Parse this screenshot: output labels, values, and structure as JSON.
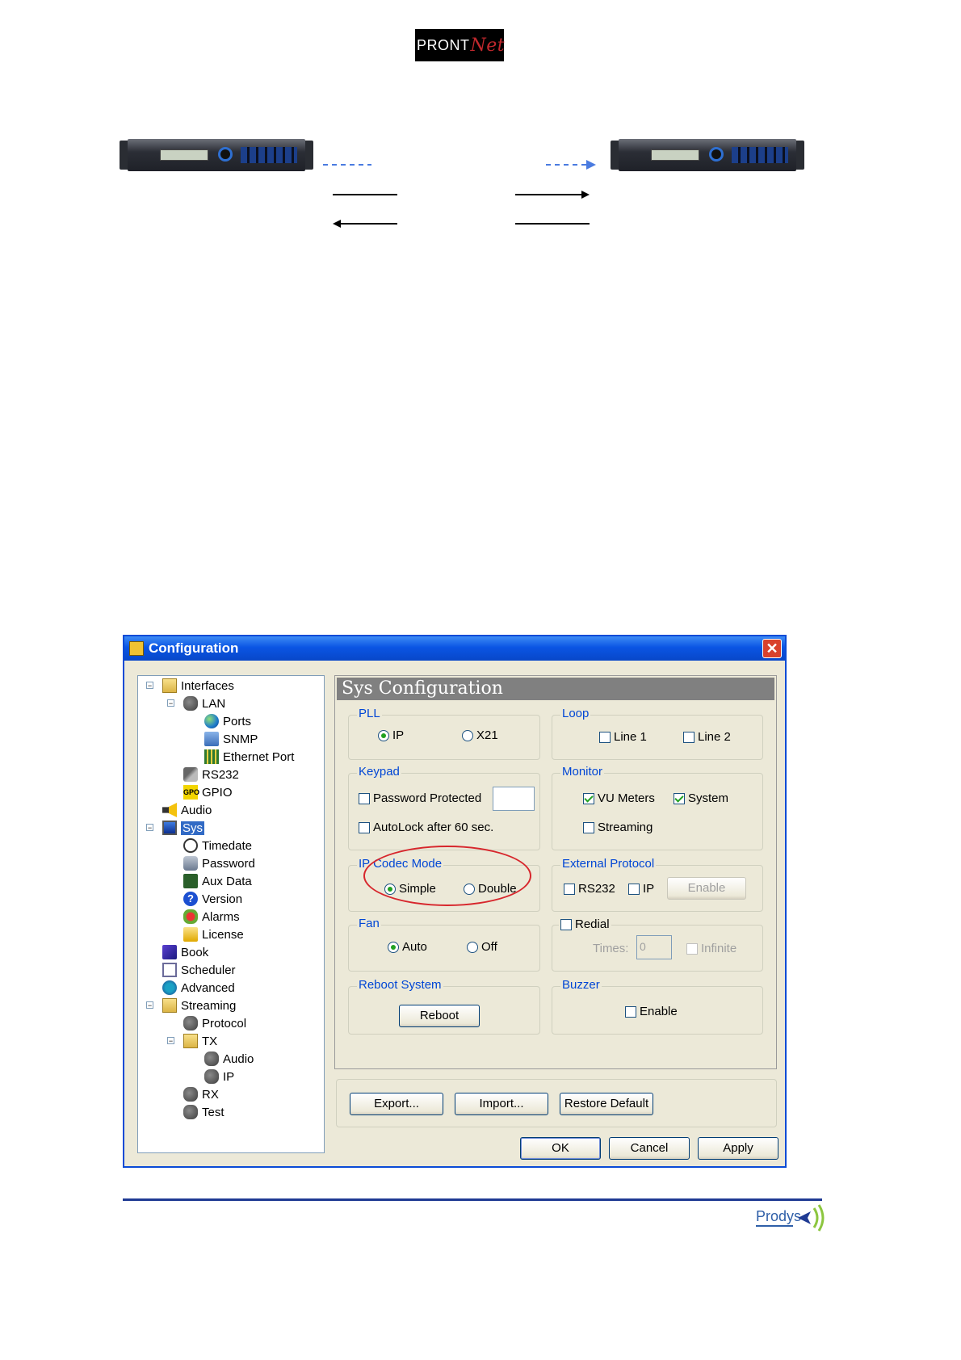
{
  "header": {
    "logo_text": "PRONT",
    "logo_mark": "Net"
  },
  "colors": {
    "window_border": "#0a4bd6",
    "title_bar": "#0a55e4",
    "group_label": "#0046d5",
    "check_green": "#21a121",
    "highlight_circle": "#d7262c",
    "footer_rule": "#1f3a93"
  },
  "window": {
    "title": "Configuration",
    "close_icon": "close-icon",
    "tree": [
      {
        "label": "Interfaces",
        "icon": "folder-icon"
      },
      {
        "label": "LAN",
        "icon": "network-icon"
      },
      {
        "label": "Ports",
        "icon": "globe-icon"
      },
      {
        "label": "SNMP",
        "icon": "snmp-icon"
      },
      {
        "label": "Ethernet Port",
        "icon": "ethernet-icon"
      },
      {
        "label": "RS232",
        "icon": "serial-icon"
      },
      {
        "label": "GPIO",
        "icon": "gpio-icon",
        "icon_text": "GPO"
      },
      {
        "label": "Audio",
        "icon": "speaker-icon"
      },
      {
        "label": "Sys",
        "icon": "monitor-icon",
        "selected": true
      },
      {
        "label": "Timedate",
        "icon": "clock-icon"
      },
      {
        "label": "Password",
        "icon": "key-icon"
      },
      {
        "label": "Aux Data",
        "icon": "aux-icon"
      },
      {
        "label": "Version",
        "icon": "help-icon"
      },
      {
        "label": "Alarms",
        "icon": "alarm-icon"
      },
      {
        "label": "License",
        "icon": "license-icon"
      },
      {
        "label": "Book",
        "icon": "book-icon"
      },
      {
        "label": "Scheduler",
        "icon": "scheduler-icon"
      },
      {
        "label": "Advanced",
        "icon": "advanced-icon"
      },
      {
        "label": "Streaming",
        "icon": "folder-icon"
      },
      {
        "label": "Protocol",
        "icon": "network-icon"
      },
      {
        "label": "TX",
        "icon": "folder-icon"
      },
      {
        "label": "Audio",
        "icon": "network-icon"
      },
      {
        "label": "IP",
        "icon": "network-icon"
      },
      {
        "label": "RX",
        "icon": "network-icon"
      },
      {
        "label": "Test",
        "icon": "network-icon"
      }
    ],
    "panel_title": "Sys Configuration",
    "pll": {
      "label": "PLL",
      "options": [
        "IP",
        "X21"
      ],
      "selected": "IP"
    },
    "loop": {
      "label": "Loop",
      "options": [
        "Line 1",
        "Line 2"
      ],
      "checked": [
        false,
        false
      ]
    },
    "keypad": {
      "label": "Keypad",
      "password_protected": "Password Protected",
      "password_checked": false,
      "autolock": "AutoLock after 60 sec.",
      "autolock_checked": false
    },
    "monitor": {
      "label": "Monitor",
      "vu_meters": "VU Meters",
      "vu_checked": true,
      "system": "System",
      "system_checked": true,
      "streaming": "Streaming",
      "streaming_checked": false
    },
    "ip_codec_mode": {
      "label": "IP Codec Mode",
      "options": [
        "Simple",
        "Double"
      ],
      "selected": "Simple"
    },
    "external_protocol": {
      "label": "External Protocol",
      "rs232": "RS232",
      "ip": "IP",
      "rs232_checked": false,
      "ip_checked": false,
      "enable_button": "Enable"
    },
    "fan": {
      "label": "Fan",
      "options": [
        "Auto",
        "Off"
      ],
      "selected": "Auto"
    },
    "redial": {
      "label": "Redial",
      "checked": false,
      "times_label": "Times:",
      "times_value": "0",
      "infinite": "Infinite",
      "infinite_checked": false
    },
    "reboot": {
      "label": "Reboot System",
      "button": "Reboot"
    },
    "buzzer": {
      "label": "Buzzer",
      "enable": "Enable",
      "checked": false
    },
    "export_button": "Export...",
    "import_button": "Import...",
    "restore_button": "Restore Default",
    "ok_button": "OK",
    "cancel_button": "Cancel",
    "apply_button": "Apply"
  },
  "footer": {
    "brand": "Prodys"
  }
}
